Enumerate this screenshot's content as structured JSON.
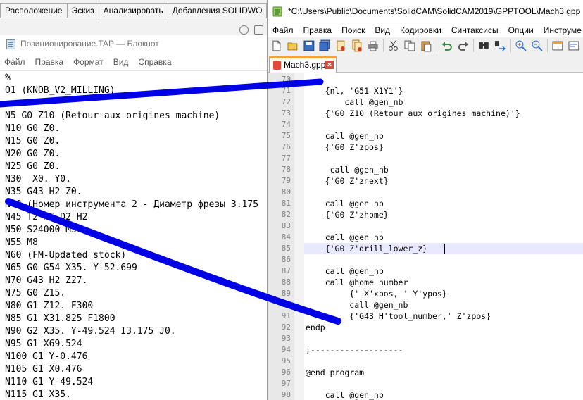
{
  "solidworks": {
    "tabs": [
      "Расположение",
      "Эскиз",
      "Анализировать",
      "Добавления SOLIDWO"
    ]
  },
  "notepad": {
    "title": "Позиционирование.TAP — Блокнот",
    "menu": [
      "Файл",
      "Правка",
      "Формат",
      "Вид",
      "Справка"
    ],
    "lines": [
      "%",
      "O1 (KNOB_V2_MILLING)",
      "",
      "N5 G0 Z10 (Retour aux origines machine)",
      "N10 G0 Z0.",
      "N15 G0 Z0.",
      "N20 G0 Z0.",
      "N25 G0 Z0.",
      "N30  X0. Y0.",
      "N35 G43 H2 Z0.",
      "N40 (Номер инструмента 2 - Диаметр фрезы 3.175",
      "N45 T2 M6 D2 H2",
      "N50 S24000 M3",
      "N55 M8",
      "N60 (FM-Updated stock)",
      "N65 G0 G54 X35. Y-52.699",
      "N70 G43 H2 Z27.",
      "N75 G0 Z15.",
      "N80 G1 Z12. F300",
      "N85 G1 X31.825 F1800",
      "N90 G2 X35. Y-49.524 I3.175 J0.",
      "N95 G1 X69.524",
      "N100 G1 Y-0.476",
      "N105 G1 X0.476",
      "N110 G1 Y-49.524",
      "N115 G1 X35."
    ]
  },
  "notepadpp": {
    "title": "*C:\\Users\\Public\\Documents\\SolidCAM\\SolidCAM2019\\GPPTOOL\\Mach3.gpp - ",
    "menu": [
      "Файл",
      "Правка",
      "Поиск",
      "Вид",
      "Кодировки",
      "Синтаксисы",
      "Опции",
      "Инструме"
    ],
    "tab_label": "Mach3.gpp",
    "current_line": "85",
    "lines": [
      {
        "n": "70",
        "text": ""
      },
      {
        "n": "71",
        "text": "    {nl, 'G51 X1Y1'}"
      },
      {
        "n": "72",
        "text": "        call @gen_nb"
      },
      {
        "n": "73",
        "text": "    {'G0 Z10 (Retour aux origines machine)'}"
      },
      {
        "n": "74",
        "text": ""
      },
      {
        "n": "75",
        "text": "    call @gen_nb"
      },
      {
        "n": "76",
        "text": "    {'G0 Z'zpos}"
      },
      {
        "n": "77",
        "text": ""
      },
      {
        "n": "78",
        "text": "     call @gen_nb"
      },
      {
        "n": "79",
        "text": "    {'G0 Z'znext}"
      },
      {
        "n": "80",
        "text": ""
      },
      {
        "n": "81",
        "text": "    call @gen_nb"
      },
      {
        "n": "82",
        "text": "    {'G0 Z'zhome}"
      },
      {
        "n": "83",
        "text": ""
      },
      {
        "n": "84",
        "text": "    call @gen_nb"
      },
      {
        "n": "85",
        "text": "    {'G0 Z'drill_lower_z}"
      },
      {
        "n": "86",
        "text": ""
      },
      {
        "n": "87",
        "text": "    call @gen_nb"
      },
      {
        "n": "88",
        "text": "    call @home_number"
      },
      {
        "n": "89",
        "text": "         {' X'xpos, ' Y'ypos}"
      },
      {
        "n": "90",
        "text": "         call @gen_nb"
      },
      {
        "n": "91",
        "text": "         {'G43 H'tool_number,' Z'zpos}"
      },
      {
        "n": "92",
        "text": "endp"
      },
      {
        "n": "93",
        "text": ""
      },
      {
        "n": "94",
        "text": ";-------------------"
      },
      {
        "n": "95",
        "text": ""
      },
      {
        "n": "96",
        "text": "@end_program"
      },
      {
        "n": "97",
        "text": ""
      },
      {
        "n": "98",
        "text": "    call @gen_nb"
      }
    ]
  },
  "colors": {
    "annotation_stroke": "#0000e6",
    "current_line_highlight": "#e8e8ff",
    "tab_accent": "#f3a33a"
  }
}
